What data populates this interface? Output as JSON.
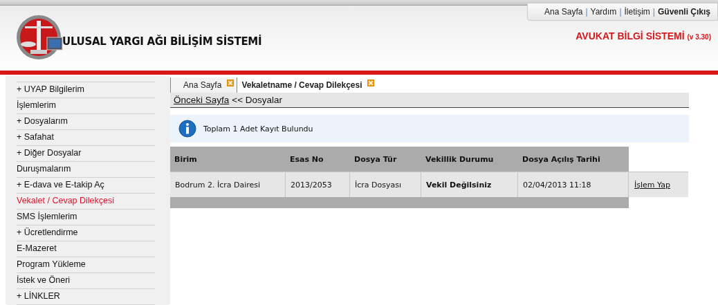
{
  "top_link_separator": "|",
  "top_links": [
    {
      "label": "Ana Sayfa",
      "bold": false
    },
    {
      "label": "Yardım",
      "bold": false
    },
    {
      "label": "İletişim",
      "bold": false
    },
    {
      "label": "Güvenli Çıkış",
      "bold": true
    }
  ],
  "brand": {
    "title": "ULUSAL YARGI AĞI BİLİŞİM SİSTEMİ"
  },
  "system": {
    "title": "AVUKAT BİLGİ SİSTEMİ",
    "version": "(v 3.30)"
  },
  "sidebar": {
    "items": [
      {
        "label": "+ UYAP Bilgilerim",
        "selected": false
      },
      {
        "label": "İşlemlerim",
        "selected": false
      },
      {
        "label": "+ Dosyalarım",
        "selected": false
      },
      {
        "label": "+ Safahat",
        "selected": false
      },
      {
        "label": "+ Diğer Dosyalar",
        "selected": false
      },
      {
        "label": "Duruşmalarım",
        "selected": false
      },
      {
        "label": "+ E-dava ve E-takip Aç",
        "selected": false
      },
      {
        "label": "Vekalet / Cevap Dilekçesi",
        "selected": true
      },
      {
        "label": "SMS İşlemlerim",
        "selected": false
      },
      {
        "label": "+ Ücretlendirme",
        "selected": false
      },
      {
        "label": "E-Mazeret",
        "selected": false
      },
      {
        "label": "Program Yükleme",
        "selected": false
      },
      {
        "label": "İstek ve Öneri",
        "selected": false
      },
      {
        "label": "+ LİNKLER",
        "selected": false
      }
    ]
  },
  "tabs": [
    {
      "label": "Ana Sayfa",
      "selected": false
    },
    {
      "label": "Vekaletname / Cevap Dilekçesi",
      "selected": true
    }
  ],
  "breadcrumb": {
    "link": "Önceki Sayfa",
    "rest": "<< Dosyalar"
  },
  "info": {
    "message": "Toplam 1 Adet Kayıt Bulundu"
  },
  "table": {
    "columns": [
      "Birim",
      "Esas No",
      "Dosya Tür",
      "Vekillik Durumu",
      "Dosya Açılış Tarihi"
    ],
    "rows": [
      {
        "cells": [
          "Bodrum 2. İcra Dairesi",
          "2013/2053",
          "İcra Dosyası",
          "Vekil Değilsiniz",
          "02/04/2013 11:18"
        ],
        "action": "İşlem Yap"
      }
    ]
  }
}
